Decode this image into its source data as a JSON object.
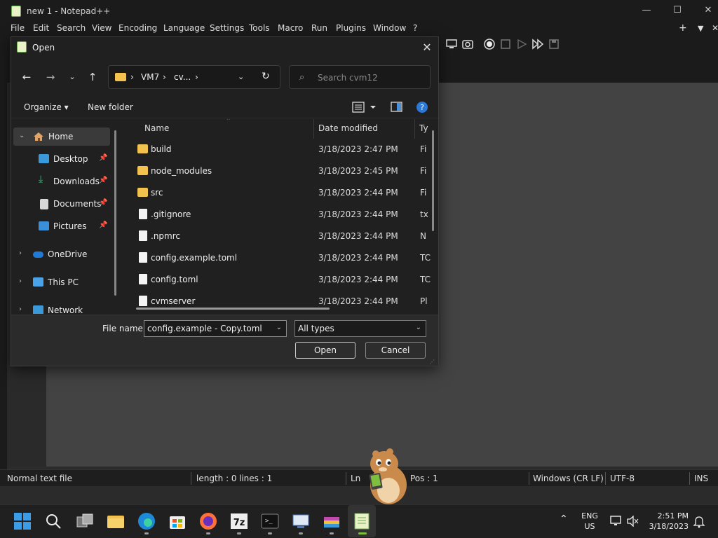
{
  "app": {
    "title": "new 1 - Notepad++",
    "menu": [
      "File",
      "Edit",
      "Search",
      "View",
      "Encoding",
      "Language",
      "Settings",
      "Tools",
      "Macro",
      "Run",
      "Plugins",
      "Window",
      "?"
    ],
    "tab_actions": {
      "add": "+",
      "list": "▼",
      "close": "✕"
    }
  },
  "status_bar": {
    "file_type": "Normal text file",
    "length": "length : 0",
    "lines": "lines : 1",
    "ln": "Ln",
    "pos": "Pos : 1",
    "eol": "Windows (CR LF)",
    "encoding": "UTF-8",
    "mode": "INS"
  },
  "dialog": {
    "title": "Open",
    "close": "✕",
    "address": {
      "segments": [
        "VM7",
        "cv...",
        "›"
      ],
      "separator": "›"
    },
    "search_placeholder": "Search cvm12",
    "commands": {
      "organize": "Organize ▾",
      "new_folder": "New folder"
    },
    "nav_pane": [
      {
        "label": "Home",
        "icon": "home-icon",
        "expandable": true,
        "selected": true
      },
      {
        "label": "Desktop",
        "icon": "desktop-icon",
        "pinned": true
      },
      {
        "label": "Downloads",
        "icon": "download-icon",
        "pinned": true
      },
      {
        "label": "Documents",
        "icon": "documents-icon",
        "pinned": true
      },
      {
        "label": "Pictures",
        "icon": "pictures-icon",
        "pinned": true
      },
      {
        "label": "OneDrive",
        "icon": "cloud-icon",
        "expandable": true
      },
      {
        "label": "This PC",
        "icon": "computer-icon",
        "expandable": true
      },
      {
        "label": "Network",
        "icon": "network-icon",
        "expandable": true
      }
    ],
    "columns": {
      "name": "Name",
      "date": "Date modified",
      "type": "Ty"
    },
    "files": [
      {
        "name": "build",
        "kind": "folder",
        "date": "3/18/2023 2:47 PM",
        "type": "Fi"
      },
      {
        "name": "node_modules",
        "kind": "folder",
        "date": "3/18/2023 2:45 PM",
        "type": "Fi"
      },
      {
        "name": "src",
        "kind": "folder",
        "date": "3/18/2023 2:44 PM",
        "type": "Fi"
      },
      {
        "name": ".gitignore",
        "kind": "file",
        "date": "3/18/2023 2:44 PM",
        "type": "tx"
      },
      {
        "name": ".npmrc",
        "kind": "file",
        "date": "3/18/2023 2:44 PM",
        "type": "N"
      },
      {
        "name": "config.example.toml",
        "kind": "file",
        "date": "3/18/2023 2:44 PM",
        "type": "TC"
      },
      {
        "name": "config.toml",
        "kind": "file",
        "date": "3/18/2023 2:44 PM",
        "type": "TC"
      },
      {
        "name": "cvmserver",
        "kind": "file",
        "date": "3/18/2023 2:44 PM",
        "type": "Pl"
      }
    ],
    "file_name_label": "File name:",
    "file_name_value": "config.example - Copy.toml",
    "file_type_value": "All types",
    "open_button": "Open",
    "cancel_button": "Cancel"
  },
  "taskbar": {
    "apps": [
      "start",
      "search",
      "task-view",
      "file-explorer",
      "edge",
      "store",
      "firefox",
      "7zip",
      "terminal",
      "remote-desktop",
      "winrar",
      "notepad-plus-plus"
    ],
    "lang_top": "ENG",
    "lang_bottom": "US",
    "time": "2:51 PM",
    "date": "3/18/2023"
  }
}
